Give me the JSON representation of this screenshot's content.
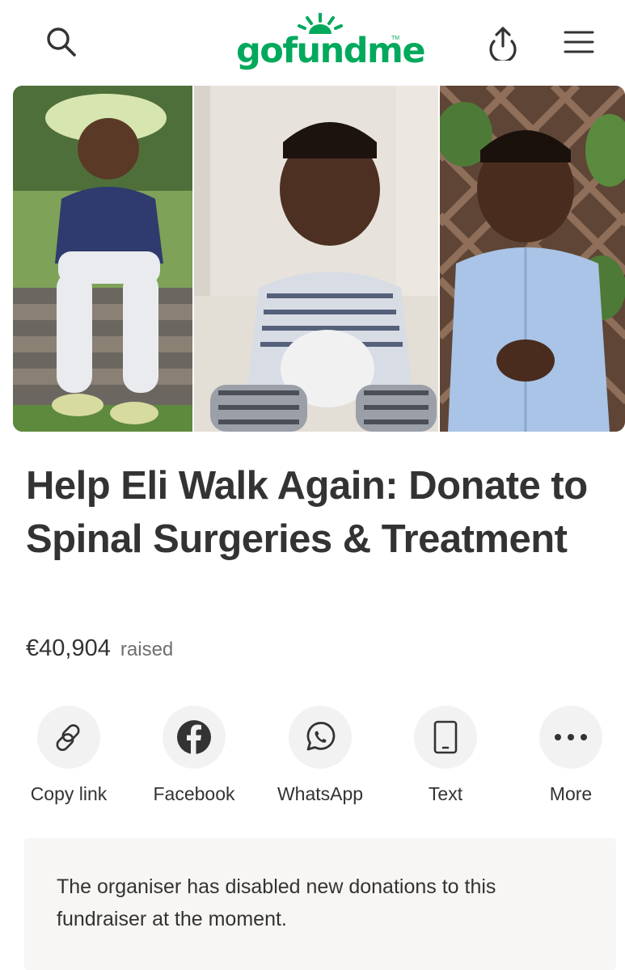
{
  "header": {
    "logo_text": "gofundme",
    "logo_tm": "TM",
    "brand_color": "#02a95c",
    "icons": [
      "search-icon",
      "share-upload-icon",
      "hamburger-menu-icon"
    ]
  },
  "hero": {
    "photos": [
      "child-in-sun-hat-photo",
      "child-in-striped-shirt-photo",
      "child-in-blue-shirt-photo"
    ]
  },
  "campaign": {
    "title": "Help Eli Walk Again: Donate to Spinal Surgeries & Treatment",
    "amount": "€40,904",
    "raised_label": "raised"
  },
  "share": {
    "items": [
      {
        "label": "Copy link",
        "icon": "link-icon"
      },
      {
        "label": "Facebook",
        "icon": "facebook-icon"
      },
      {
        "label": "WhatsApp",
        "icon": "whatsapp-icon"
      },
      {
        "label": "Text",
        "icon": "phone-icon"
      },
      {
        "label": "More",
        "icon": "more-dots-icon"
      }
    ]
  },
  "notice": {
    "text": "The organiser has disabled new donations to this fundraiser at the moment."
  }
}
